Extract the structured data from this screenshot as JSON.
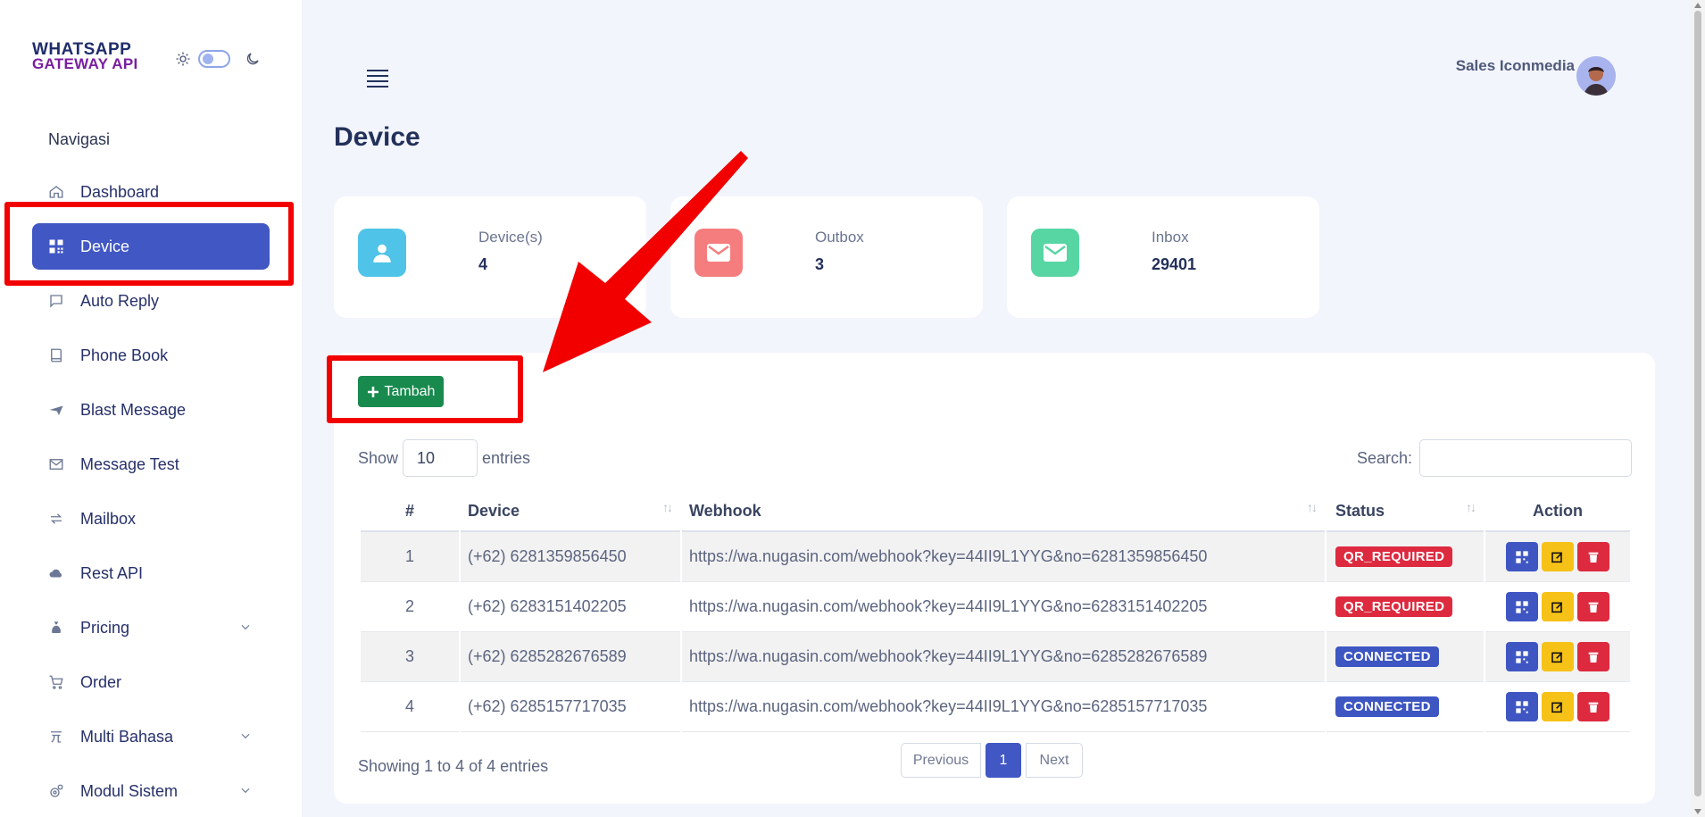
{
  "logo": {
    "line1": "WHATSAPP",
    "line2": "GATEWAY API"
  },
  "sidebar": {
    "nav_title": "Navigasi",
    "items": [
      {
        "label": "Dashboard",
        "icon": "home-icon"
      },
      {
        "label": "Device",
        "icon": "qr-icon",
        "active": true
      },
      {
        "label": "Auto Reply",
        "icon": "chat-icon"
      },
      {
        "label": "Phone Book",
        "icon": "book-icon"
      },
      {
        "label": "Blast Message",
        "icon": "send-icon"
      },
      {
        "label": "Message Test",
        "icon": "mail-icon"
      },
      {
        "label": "Mailbox",
        "icon": "swap-icon"
      },
      {
        "label": "Rest API",
        "icon": "cloud-icon"
      },
      {
        "label": "Pricing",
        "icon": "money-bag-icon",
        "expandable": true
      },
      {
        "label": "Order",
        "icon": "cart-icon"
      },
      {
        "label": "Multi Bahasa",
        "icon": "language-icon",
        "expandable": true
      },
      {
        "label": "Modul Sistem",
        "icon": "settings-icon",
        "expandable": true
      }
    ]
  },
  "header": {
    "user_name": "Sales Iconmedia"
  },
  "page": {
    "title": "Device"
  },
  "stats": [
    {
      "label": "Device(s)",
      "value": "4",
      "color": "#4fc3e8",
      "icon": "user-icon"
    },
    {
      "label": "Outbox",
      "value": "3",
      "color": "#f57d7d",
      "icon": "envelope-icon"
    },
    {
      "label": "Inbox",
      "value": "29401",
      "color": "#57d6a4",
      "icon": "envelope-icon"
    }
  ],
  "toolbar": {
    "add_label": "Tambah"
  },
  "table_controls": {
    "show": "Show",
    "entries_value": "10",
    "entries": "entries",
    "search": "Search:"
  },
  "table": {
    "columns": [
      "#",
      "Device",
      "Webhook",
      "Status",
      "Action"
    ],
    "rows": [
      {
        "no": "1",
        "device": "(+62) 6281359856450",
        "webhook": "https://wa.nugasin.com/webhook?key=44II9L1YYG&no=6281359856450",
        "status": "QR_REQUIRED"
      },
      {
        "no": "2",
        "device": "(+62) 6283151402205",
        "webhook": "https://wa.nugasin.com/webhook?key=44II9L1YYG&no=6283151402205",
        "status": "QR_REQUIRED"
      },
      {
        "no": "3",
        "device": "(+62) 6285282676589",
        "webhook": "https://wa.nugasin.com/webhook?key=44II9L1YYG&no=6285282676589",
        "status": "CONNECTED"
      },
      {
        "no": "4",
        "device": "(+62) 6285157717035",
        "webhook": "https://wa.nugasin.com/webhook?key=44II9L1YYG&no=6285157717035",
        "status": "CONNECTED"
      }
    ]
  },
  "footer": {
    "showing": "Showing 1 to 4 of 4 entries",
    "prev": "Previous",
    "page": "1",
    "next": "Next"
  },
  "colors": {
    "primary": "#4157c4",
    "success": "#198a4e",
    "danger": "#dd2a3f",
    "warning": "#f7c218",
    "annotation": "#f20000"
  }
}
